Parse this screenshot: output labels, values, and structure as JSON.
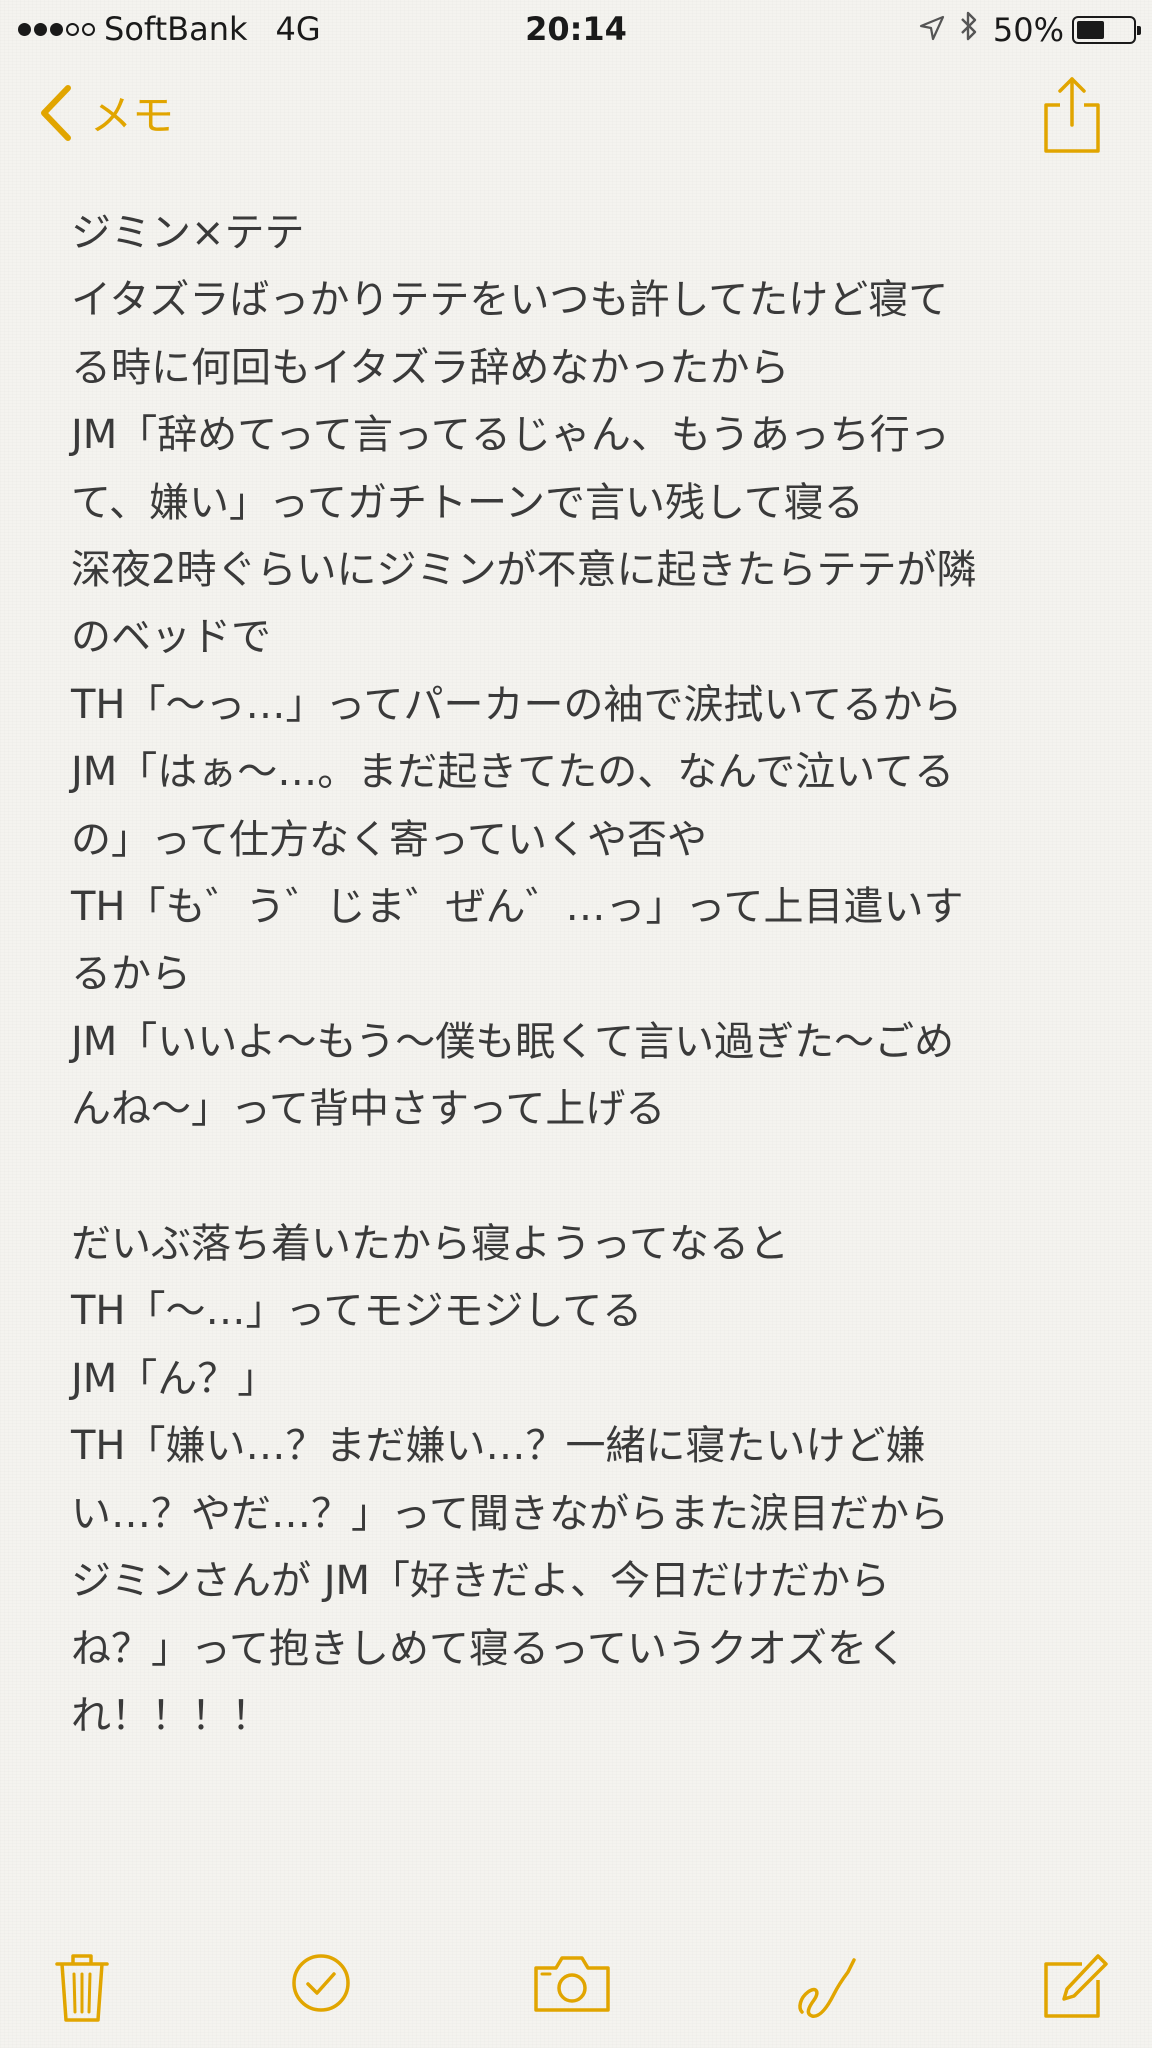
{
  "status_bar": {
    "carrier": "SoftBank",
    "network": "4G",
    "time": "20:14",
    "battery_percent": "50%",
    "battery_level": 0.5,
    "signal_bars": 3
  },
  "nav": {
    "back_label": "メモ"
  },
  "note": {
    "lines": [
      "ジミン×テテ",
      "イタズラばっかりテテをいつも許してたけど寝て",
      "る時に何回もイタズラ辞めなかったから",
      "JM「辞めてって言ってるじゃん、もうあっち行っ",
      "て、嫌い」ってガチトーンで言い残して寝る",
      "深夜2時ぐらいにジミンが不意に起きたらテテが隣",
      "のベッドで",
      "TH「〜っ…」ってパーカーの袖で涙拭いてるから",
      "JM「はぁ〜…。まだ起きてたの、なんで泣いてる",
      "の」って仕方なく寄っていくや否や",
      "TH「も゛う゛じま゛ぜん゛…っ」って上目遣いす",
      "るから",
      "JM「いいよ〜もう〜僕も眠くて言い過ぎた〜ごめ",
      "んね〜」って背中さすって上げる",
      "",
      "だいぶ落ち着いたから寝ようってなると",
      "TH「〜…」ってモジモジしてる",
      "JM「ん？」",
      "TH「嫌い…？まだ嫌い…？一緒に寝たいけど嫌",
      "い…？やだ…？」って聞きながらまた涙目だから",
      "ジミンさんが JM「好きだよ、今日だけだから",
      "ね？」って抱きしめて寝るっていうクオズをく",
      "れ！！！！"
    ]
  },
  "toolbar": {
    "icons": [
      "trash-icon",
      "checklist-icon",
      "camera-icon",
      "sketch-icon",
      "compose-icon"
    ]
  },
  "colors": {
    "accent": "#e1a500",
    "text": "#3a3a3a",
    "paper": "#f4f3ef"
  }
}
